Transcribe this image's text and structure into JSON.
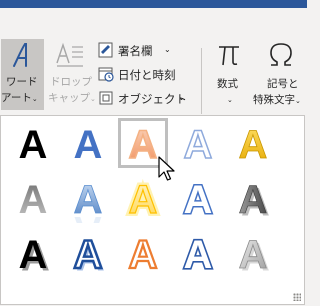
{
  "ribbon": {
    "word_art": {
      "line1": "ワード",
      "line2": "アート",
      "chev": "⌄"
    },
    "drop_cap": {
      "line1": "ドロップ",
      "line2": "キャップ",
      "chev": "⌄"
    },
    "signature_line": {
      "label": "署名欄",
      "chev": "⌄"
    },
    "date_time": {
      "label": "日付と時刻"
    },
    "object": {
      "label": "オブジェクト",
      "chev": "⌄"
    },
    "equation": {
      "label": "数式",
      "chev": "⌄"
    },
    "symbol": {
      "line1": "記号と",
      "line2": "特殊文字",
      "chev": "⌄"
    }
  },
  "gallery": {
    "letter": "A",
    "selected_index": 2,
    "styles": [
      "black-solid",
      "blue-solid",
      "orange-outline-gradient",
      "light-blue-outline",
      "gold-gradient",
      "gray-gradient",
      "blue-reflection",
      "yellow-outline-glow",
      "blue-outline-double",
      "gray-bevel",
      "black-shadow",
      "blue-outline-white-fill",
      "orange-outline-white",
      "blue-outline-thick",
      "silver-gradient"
    ]
  },
  "colors": {
    "title_bar": "#2b579a",
    "ribbon_bg": "#f3f2f1",
    "accent_blue": "#2b579a"
  }
}
